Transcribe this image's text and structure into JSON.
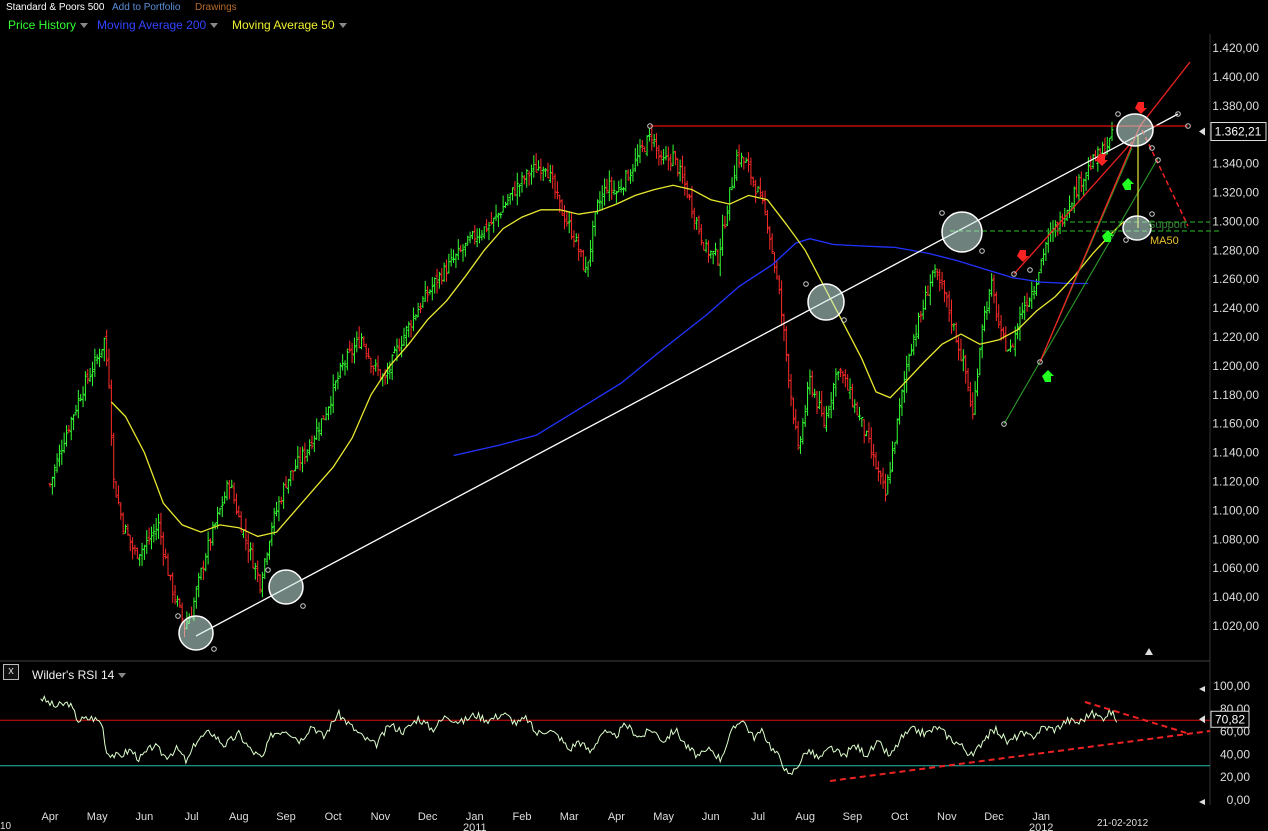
{
  "toolbar": {
    "instrument": "Standard & Poors 500",
    "add_to_portfolio": "Add to Portfolio",
    "drawings": "Drawings"
  },
  "legend": {
    "price_history": "Price History",
    "ma200": "Moving Average 200",
    "ma50": "Moving Average 50"
  },
  "colors": {
    "price_up": "#33ff33",
    "price_down": "#ff2a2a",
    "ma200": "#2233ff",
    "ma50": "#e8e830",
    "trendline": "#ffffff",
    "resistance": "#dd1111",
    "support_dash": "#229922",
    "rsi_line": "#ddffcc",
    "rsi_upper": "#dd1111",
    "rsi_lower": "#22bbaa"
  },
  "annotations": {
    "support_text": "Support",
    "ma50_text": "MA50",
    "last_date": "21-02-2012",
    "corner_label": "10"
  },
  "rsi_panel": {
    "close_glyph": "x",
    "label": "Wilder's RSI 14"
  },
  "chart_data": [
    {
      "type": "line",
      "subtype": "ohlc-bars",
      "title": "Standard & Poors 500",
      "y_ticks": [
        "1.420,00",
        "1.400,00",
        "1.380,00",
        "1.360,00",
        "1.340,00",
        "1.320,00",
        "1.300,00",
        "1.280,00",
        "1.260,00",
        "1.240,00",
        "1.220,00",
        "1.200,00",
        "1.180,00",
        "1.160,00",
        "1.140,00",
        "1.120,00",
        "1.100,00",
        "1.080,00",
        "1.060,00",
        "1.040,00",
        "1.020,00"
      ],
      "ylim": [
        1005,
        1430
      ],
      "last_price_label": "1.362,21",
      "last_price": 1362.21,
      "x_month_labels": [
        "Apr",
        "May",
        "Jun",
        "Jul",
        "Aug",
        "Sep",
        "Oct",
        "Nov",
        "Dec",
        "Jan",
        "Feb",
        "Mar",
        "Apr",
        "May",
        "Jun",
        "Jul",
        "Aug",
        "Sep",
        "Oct",
        "Nov",
        "Dec",
        "Jan"
      ],
      "x_year_labels": [
        "2011",
        "2012"
      ],
      "price_keypoints": [
        {
          "m": 0.0,
          "p": 1118
        },
        {
          "m": 0.3,
          "p": 1150
        },
        {
          "m": 0.7,
          "p": 1185
        },
        {
          "m": 1.0,
          "p": 1205
        },
        {
          "m": 1.15,
          "p": 1218
        },
        {
          "m": 1.25,
          "p": 1190
        },
        {
          "m": 1.35,
          "p": 1120
        },
        {
          "m": 1.55,
          "p": 1090
        },
        {
          "m": 1.8,
          "p": 1070
        },
        {
          "m": 2.0,
          "p": 1075
        },
        {
          "m": 2.3,
          "p": 1090
        },
        {
          "m": 2.55,
          "p": 1050
        },
        {
          "m": 2.85,
          "p": 1020
        },
        {
          "m": 3.0,
          "p": 1030
        },
        {
          "m": 3.3,
          "p": 1070
        },
        {
          "m": 3.6,
          "p": 1100
        },
        {
          "m": 3.8,
          "p": 1120
        },
        {
          "m": 4.0,
          "p": 1095
        },
        {
          "m": 4.2,
          "p": 1075
        },
        {
          "m": 4.45,
          "p": 1050
        },
        {
          "m": 4.7,
          "p": 1090
        },
        {
          "m": 5.0,
          "p": 1120
        },
        {
          "m": 5.4,
          "p": 1140
        },
        {
          "m": 5.8,
          "p": 1165
        },
        {
          "m": 6.2,
          "p": 1200
        },
        {
          "m": 6.6,
          "p": 1220
        },
        {
          "m": 6.85,
          "p": 1200
        },
        {
          "m": 7.1,
          "p": 1190
        },
        {
          "m": 7.4,
          "p": 1215
        },
        {
          "m": 7.8,
          "p": 1240
        },
        {
          "m": 8.2,
          "p": 1260
        },
        {
          "m": 8.6,
          "p": 1275
        },
        {
          "m": 9.0,
          "p": 1290
        },
        {
          "m": 9.4,
          "p": 1300
        },
        {
          "m": 9.8,
          "p": 1320
        },
        {
          "m": 10.2,
          "p": 1335
        },
        {
          "m": 10.5,
          "p": 1340
        },
        {
          "m": 10.8,
          "p": 1310
        },
        {
          "m": 11.1,
          "p": 1290
        },
        {
          "m": 11.35,
          "p": 1265
        },
        {
          "m": 11.6,
          "p": 1310
        },
        {
          "m": 11.8,
          "p": 1325
        },
        {
          "m": 12.0,
          "p": 1320
        },
        {
          "m": 12.3,
          "p": 1335
        },
        {
          "m": 12.55,
          "p": 1350
        },
        {
          "m": 12.75,
          "p": 1360
        },
        {
          "m": 12.95,
          "p": 1340
        },
        {
          "m": 13.2,
          "p": 1345
        },
        {
          "m": 13.45,
          "p": 1325
        },
        {
          "m": 13.7,
          "p": 1300
        },
        {
          "m": 13.9,
          "p": 1280
        },
        {
          "m": 14.15,
          "p": 1275
        },
        {
          "m": 14.35,
          "p": 1310
        },
        {
          "m": 14.55,
          "p": 1345
        },
        {
          "m": 14.75,
          "p": 1340
        },
        {
          "m": 15.0,
          "p": 1320
        },
        {
          "m": 15.2,
          "p": 1300
        },
        {
          "m": 15.45,
          "p": 1250
        },
        {
          "m": 15.7,
          "p": 1180
        },
        {
          "m": 15.85,
          "p": 1140
        },
        {
          "m": 16.1,
          "p": 1190
        },
        {
          "m": 16.4,
          "p": 1160
        },
        {
          "m": 16.7,
          "p": 1200
        },
        {
          "m": 16.95,
          "p": 1180
        },
        {
          "m": 17.2,
          "p": 1160
        },
        {
          "m": 17.45,
          "p": 1135
        },
        {
          "m": 17.7,
          "p": 1110
        },
        {
          "m": 17.95,
          "p": 1160
        },
        {
          "m": 18.2,
          "p": 1210
        },
        {
          "m": 18.45,
          "p": 1235
        },
        {
          "m": 18.7,
          "p": 1265
        },
        {
          "m": 18.95,
          "p": 1250
        },
        {
          "m": 19.2,
          "p": 1220
        },
        {
          "m": 19.4,
          "p": 1195
        },
        {
          "m": 19.55,
          "p": 1165
        },
        {
          "m": 19.75,
          "p": 1230
        },
        {
          "m": 19.95,
          "p": 1255
        },
        {
          "m": 20.15,
          "p": 1220
        },
        {
          "m": 20.35,
          "p": 1210
        },
        {
          "m": 20.6,
          "p": 1240
        },
        {
          "m": 20.85,
          "p": 1255
        },
        {
          "m": 21.1,
          "p": 1285
        },
        {
          "m": 21.4,
          "p": 1300
        },
        {
          "m": 21.7,
          "p": 1320
        },
        {
          "m": 21.95,
          "p": 1335
        },
        {
          "m": 22.2,
          "p": 1345
        },
        {
          "m": 22.45,
          "p": 1355
        },
        {
          "m": 22.55,
          "p": 1362
        }
      ],
      "ma50_keypoints": [
        {
          "m": 1.3,
          "p": 1175
        },
        {
          "m": 1.6,
          "p": 1165
        },
        {
          "m": 2.0,
          "p": 1140
        },
        {
          "m": 2.4,
          "p": 1105
        },
        {
          "m": 2.8,
          "p": 1090
        },
        {
          "m": 3.2,
          "p": 1085
        },
        {
          "m": 3.6,
          "p": 1090
        },
        {
          "m": 4.0,
          "p": 1088
        },
        {
          "m": 4.4,
          "p": 1082
        },
        {
          "m": 4.8,
          "p": 1085
        },
        {
          "m": 5.2,
          "p": 1100
        },
        {
          "m": 5.6,
          "p": 1115
        },
        {
          "m": 6.0,
          "p": 1130
        },
        {
          "m": 6.4,
          "p": 1150
        },
        {
          "m": 6.8,
          "p": 1180
        },
        {
          "m": 7.2,
          "p": 1200
        },
        {
          "m": 7.6,
          "p": 1215
        },
        {
          "m": 8.0,
          "p": 1232
        },
        {
          "m": 8.4,
          "p": 1245
        },
        {
          "m": 8.8,
          "p": 1262
        },
        {
          "m": 9.2,
          "p": 1280
        },
        {
          "m": 9.6,
          "p": 1295
        },
        {
          "m": 10.0,
          "p": 1303
        },
        {
          "m": 10.4,
          "p": 1308
        },
        {
          "m": 10.8,
          "p": 1308
        },
        {
          "m": 11.2,
          "p": 1305
        },
        {
          "m": 11.6,
          "p": 1307
        },
        {
          "m": 12.0,
          "p": 1312
        },
        {
          "m": 12.4,
          "p": 1318
        },
        {
          "m": 12.8,
          "p": 1322
        },
        {
          "m": 13.2,
          "p": 1325
        },
        {
          "m": 13.6,
          "p": 1322
        },
        {
          "m": 14.0,
          "p": 1315
        },
        {
          "m": 14.4,
          "p": 1312
        },
        {
          "m": 14.8,
          "p": 1318
        },
        {
          "m": 15.2,
          "p": 1315
        },
        {
          "m": 15.6,
          "p": 1298
        },
        {
          "m": 16.0,
          "p": 1280
        },
        {
          "m": 16.4,
          "p": 1255
        },
        {
          "m": 16.8,
          "p": 1230
        },
        {
          "m": 17.2,
          "p": 1205
        },
        {
          "m": 17.5,
          "p": 1182
        },
        {
          "m": 17.8,
          "p": 1178
        },
        {
          "m": 18.1,
          "p": 1188
        },
        {
          "m": 18.5,
          "p": 1202
        },
        {
          "m": 18.9,
          "p": 1215
        },
        {
          "m": 19.3,
          "p": 1222
        },
        {
          "m": 19.7,
          "p": 1215
        },
        {
          "m": 20.1,
          "p": 1218
        },
        {
          "m": 20.5,
          "p": 1225
        },
        {
          "m": 20.9,
          "p": 1238
        },
        {
          "m": 21.3,
          "p": 1248
        },
        {
          "m": 21.7,
          "p": 1262
        },
        {
          "m": 22.1,
          "p": 1278
        },
        {
          "m": 22.5,
          "p": 1292
        },
        {
          "m": 22.75,
          "p": 1300
        }
      ],
      "ma200_keypoints": [
        {
          "m": 8.55,
          "p": 1138
        },
        {
          "m": 9.5,
          "p": 1145
        },
        {
          "m": 10.3,
          "p": 1152
        },
        {
          "m": 11.2,
          "p": 1170
        },
        {
          "m": 12.1,
          "p": 1188
        },
        {
          "m": 13.0,
          "p": 1212
        },
        {
          "m": 13.9,
          "p": 1235
        },
        {
          "m": 14.6,
          "p": 1255
        },
        {
          "m": 15.3,
          "p": 1270
        },
        {
          "m": 15.8,
          "p": 1285
        },
        {
          "m": 16.1,
          "p": 1288
        },
        {
          "m": 16.6,
          "p": 1284
        },
        {
          "m": 17.2,
          "p": 1283
        },
        {
          "m": 17.9,
          "p": 1282
        },
        {
          "m": 18.6,
          "p": 1278
        },
        {
          "m": 19.2,
          "p": 1273
        },
        {
          "m": 19.8,
          "p": 1267
        },
        {
          "m": 20.4,
          "p": 1261
        },
        {
          "m": 21.0,
          "p": 1258
        },
        {
          "m": 21.6,
          "p": 1257
        },
        {
          "m": 22.0,
          "p": 1257
        }
      ]
    },
    {
      "type": "line",
      "title": "Wilder's RSI 14",
      "y_ticks": [
        "100,00",
        "80,00",
        "60,00",
        "40,00",
        "20,00",
        "0,00"
      ],
      "ylim": [
        0,
        100
      ],
      "upper_level": 70,
      "lower_level": 30,
      "last_value_label": "70,82",
      "last_value": 70.82,
      "rsi_keypoints": [
        {
          "m": -0.2,
          "p": 90
        },
        {
          "m": 0.1,
          "p": 82
        },
        {
          "m": 0.4,
          "p": 85
        },
        {
          "m": 0.6,
          "p": 70
        },
        {
          "m": 0.9,
          "p": 72
        },
        {
          "m": 1.1,
          "p": 68
        },
        {
          "m": 1.2,
          "p": 42
        },
        {
          "m": 1.45,
          "p": 38
        },
        {
          "m": 1.7,
          "p": 44
        },
        {
          "m": 1.9,
          "p": 36
        },
        {
          "m": 2.2,
          "p": 48
        },
        {
          "m": 2.45,
          "p": 38
        },
        {
          "m": 2.7,
          "p": 45
        },
        {
          "m": 2.9,
          "p": 33
        },
        {
          "m": 3.1,
          "p": 52
        },
        {
          "m": 3.4,
          "p": 60
        },
        {
          "m": 3.7,
          "p": 48
        },
        {
          "m": 4.0,
          "p": 58
        },
        {
          "m": 4.25,
          "p": 44
        },
        {
          "m": 4.5,
          "p": 36
        },
        {
          "m": 4.7,
          "p": 58
        },
        {
          "m": 5.0,
          "p": 62
        },
        {
          "m": 5.3,
          "p": 52
        },
        {
          "m": 5.55,
          "p": 66
        },
        {
          "m": 5.8,
          "p": 55
        },
        {
          "m": 6.1,
          "p": 76
        },
        {
          "m": 6.4,
          "p": 64
        },
        {
          "m": 6.6,
          "p": 56
        },
        {
          "m": 6.9,
          "p": 48
        },
        {
          "m": 7.2,
          "p": 66
        },
        {
          "m": 7.5,
          "p": 60
        },
        {
          "m": 7.8,
          "p": 72
        },
        {
          "m": 8.1,
          "p": 62
        },
        {
          "m": 8.4,
          "p": 74
        },
        {
          "m": 8.7,
          "p": 68
        },
        {
          "m": 9.0,
          "p": 75
        },
        {
          "m": 9.3,
          "p": 70
        },
        {
          "m": 9.6,
          "p": 76
        },
        {
          "m": 9.9,
          "p": 67
        },
        {
          "m": 10.1,
          "p": 72
        },
        {
          "m": 10.3,
          "p": 58
        },
        {
          "m": 10.55,
          "p": 62
        },
        {
          "m": 10.8,
          "p": 55
        },
        {
          "m": 11.0,
          "p": 44
        },
        {
          "m": 11.2,
          "p": 52
        },
        {
          "m": 11.45,
          "p": 42
        },
        {
          "m": 11.7,
          "p": 60
        },
        {
          "m": 11.95,
          "p": 55
        },
        {
          "m": 12.2,
          "p": 66
        },
        {
          "m": 12.5,
          "p": 55
        },
        {
          "m": 12.75,
          "p": 62
        },
        {
          "m": 13.0,
          "p": 52
        },
        {
          "m": 13.25,
          "p": 62
        },
        {
          "m": 13.5,
          "p": 46
        },
        {
          "m": 13.75,
          "p": 38
        },
        {
          "m": 14.0,
          "p": 45
        },
        {
          "m": 14.2,
          "p": 36
        },
        {
          "m": 14.45,
          "p": 60
        },
        {
          "m": 14.65,
          "p": 72
        },
        {
          "m": 14.9,
          "p": 55
        },
        {
          "m": 15.1,
          "p": 60
        },
        {
          "m": 15.3,
          "p": 45
        },
        {
          "m": 15.5,
          "p": 35
        },
        {
          "m": 15.65,
          "p": 20
        },
        {
          "m": 15.8,
          "p": 28
        },
        {
          "m": 16.05,
          "p": 44
        },
        {
          "m": 16.3,
          "p": 36
        },
        {
          "m": 16.55,
          "p": 46
        },
        {
          "m": 16.8,
          "p": 38
        },
        {
          "m": 17.05,
          "p": 48
        },
        {
          "m": 17.3,
          "p": 40
        },
        {
          "m": 17.55,
          "p": 50
        },
        {
          "m": 17.8,
          "p": 38
        },
        {
          "m": 18.05,
          "p": 55
        },
        {
          "m": 18.3,
          "p": 62
        },
        {
          "m": 18.55,
          "p": 58
        },
        {
          "m": 18.8,
          "p": 64
        },
        {
          "m": 19.05,
          "p": 55
        },
        {
          "m": 19.3,
          "p": 48
        },
        {
          "m": 19.55,
          "p": 38
        },
        {
          "m": 19.8,
          "p": 55
        },
        {
          "m": 20.05,
          "p": 62
        },
        {
          "m": 20.3,
          "p": 50
        },
        {
          "m": 20.55,
          "p": 58
        },
        {
          "m": 20.8,
          "p": 55
        },
        {
          "m": 21.05,
          "p": 64
        },
        {
          "m": 21.3,
          "p": 62
        },
        {
          "m": 21.55,
          "p": 70
        },
        {
          "m": 21.8,
          "p": 68
        },
        {
          "m": 22.05,
          "p": 76
        },
        {
          "m": 22.3,
          "p": 72
        },
        {
          "m": 22.45,
          "p": 78
        },
        {
          "m": 22.6,
          "p": 71
        }
      ]
    }
  ]
}
